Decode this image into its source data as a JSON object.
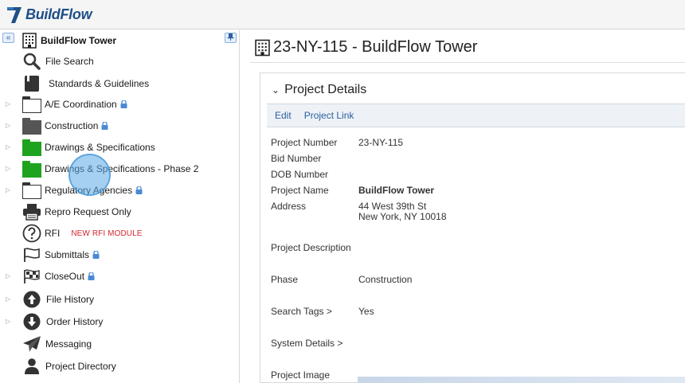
{
  "app": {
    "logo_text": "BuildFlow"
  },
  "sidebar": {
    "collapse_icon": "double-chevron-left-icon",
    "pin_icon": "pin-icon",
    "root_label": "BuildFlow Tower",
    "items": [
      {
        "label": "File Search",
        "icon": "search-icon"
      },
      {
        "label": "Standards & Guidelines",
        "icon": "book-icon"
      },
      {
        "label": "A/E Coordination",
        "icon": "folder-outline-icon",
        "locked": true
      },
      {
        "label": "Construction",
        "icon": "folder-dark-icon",
        "locked": true
      },
      {
        "label": "Drawings & Specifications",
        "icon": "folder-green-icon"
      },
      {
        "label": "Drawings & Specifications - Phase 2",
        "icon": "folder-green-icon"
      },
      {
        "label": "Regulatory Agencies",
        "icon": "folder-outline-icon",
        "locked": true
      },
      {
        "label": "Repro Request Only",
        "icon": "printer-icon"
      },
      {
        "label": "RFI",
        "icon": "question-circle-icon",
        "badge": "NEW RFI MODULE"
      },
      {
        "label": "Submittals",
        "icon": "flag-outline-icon",
        "locked": true
      },
      {
        "label": "CloseOut",
        "icon": "checkered-flag-icon",
        "locked": true
      },
      {
        "label": "File History",
        "icon": "arrow-up-circle-icon"
      },
      {
        "label": "Order History",
        "icon": "arrow-down-circle-icon"
      },
      {
        "label": "Messaging",
        "icon": "paper-plane-icon"
      },
      {
        "label": "Project Directory",
        "icon": "person-icon"
      }
    ]
  },
  "main": {
    "title": "23-NY-115 - BuildFlow Tower",
    "panel": {
      "heading": "Project Details",
      "actions": [
        "Edit",
        "Project Link"
      ],
      "fields": [
        {
          "label": "Project Number",
          "value": "23-NY-115"
        },
        {
          "label": "Bid Number",
          "value": ""
        },
        {
          "label": "DOB Number",
          "value": ""
        },
        {
          "label": "Project Name",
          "value": "BuildFlow Tower"
        },
        {
          "label": "Address",
          "value": "44 West 39th St",
          "value2": "New York, NY 10018"
        },
        {
          "label": "Project Description",
          "value": ""
        },
        {
          "label": "Phase",
          "value": "Construction"
        },
        {
          "label": "Search Tags >",
          "value": "Yes"
        },
        {
          "label": "System Details >",
          "value": ""
        },
        {
          "label": "Project Image",
          "value": ""
        }
      ]
    }
  },
  "colors": {
    "accent": "#2b5f9e",
    "folder_green": "#1fa31f",
    "folder_dark": "#555555",
    "rfi_badge": "#d4262c"
  }
}
